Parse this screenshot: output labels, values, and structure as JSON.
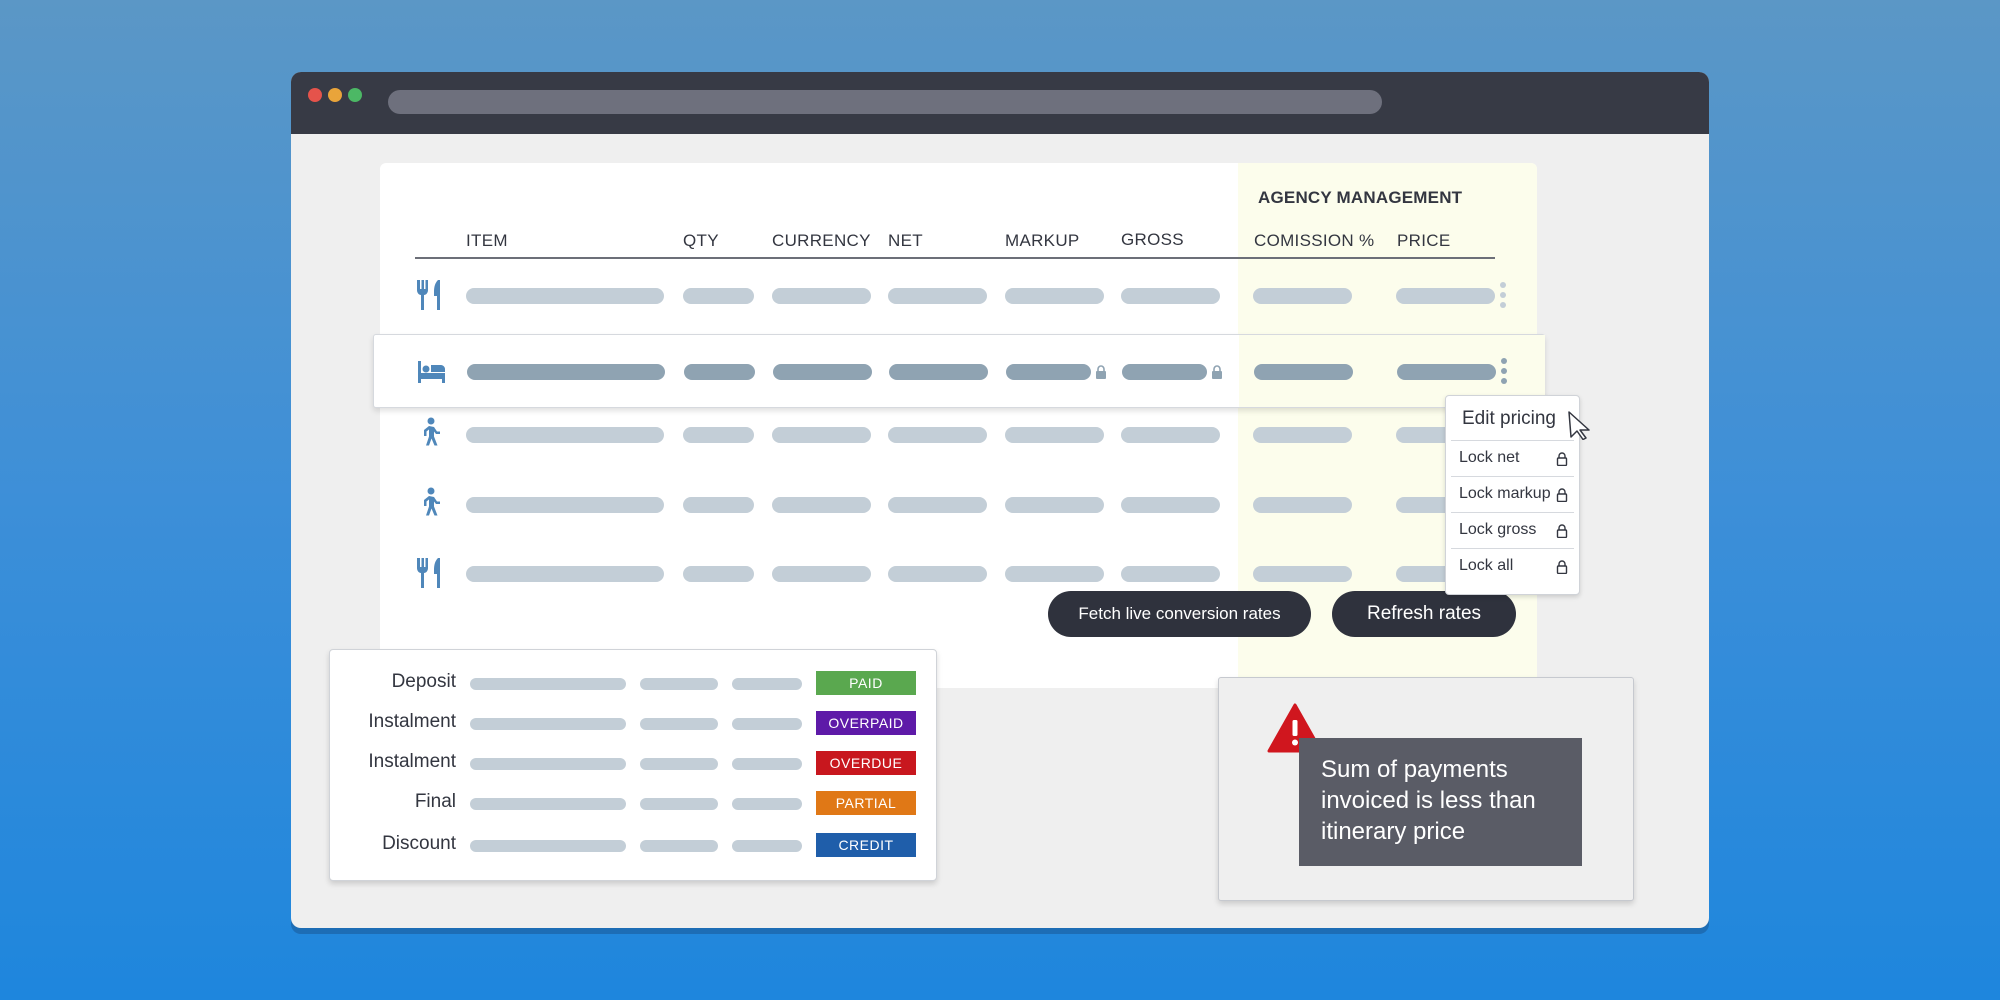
{
  "table": {
    "agency_title": "AGENCY MANAGEMENT",
    "columns": [
      "ITEM",
      "QTY",
      "CURRENCY",
      "NET",
      "MARKUP",
      "GROSS",
      "COMISSION %",
      "PRICE"
    ],
    "rows": [
      {
        "icon": "fork-knife-icon",
        "selected": false
      },
      {
        "icon": "bed-icon",
        "selected": true
      },
      {
        "icon": "walking-person-icon",
        "selected": false
      },
      {
        "icon": "walking-person-icon",
        "selected": false
      },
      {
        "icon": "fork-knife-icon",
        "selected": false
      }
    ]
  },
  "buttons": {
    "fetch_label": "Fetch live conversion rates",
    "refresh_label": "Refresh rates"
  },
  "menu": {
    "title": "Edit pricing",
    "items": [
      "Lock net",
      "Lock markup",
      "Lock gross",
      "Lock all"
    ]
  },
  "payments": [
    {
      "label": "Deposit",
      "status": "PAID",
      "color": "#5aa84f"
    },
    {
      "label": "Instalment",
      "status": "OVERPAID",
      "color": "#5e1aa8"
    },
    {
      "label": "Instalment",
      "status": "OVERDUE",
      "color": "#c8171e"
    },
    {
      "label": "Final",
      "status": "PARTIAL",
      "color": "#e07816"
    },
    {
      "label": "Discount",
      "status": "CREDIT",
      "color": "#1f5eaa"
    }
  ],
  "warning": {
    "icon": "warning-triangle-icon",
    "message": "Sum of payments invoiced is less than itinerary price"
  },
  "colors": {
    "agency_band": "#fcfdec",
    "skeleton": "#c3ced7",
    "skeleton_selected": "#8fa3b2",
    "icon_blue": "#4f87ba",
    "button_dark": "#2f323d"
  }
}
